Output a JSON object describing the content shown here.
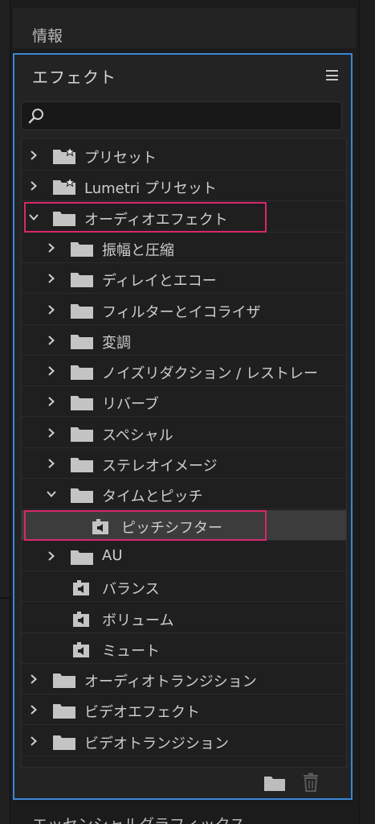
{
  "info_panel": {
    "title": "情報"
  },
  "effects_panel": {
    "title": "エフェクト",
    "search": {
      "placeholder": "",
      "value": ""
    },
    "tree": [
      {
        "label": "プリセット",
        "level": 0,
        "expanded": false,
        "icon": "preset-folder-icon",
        "has_chevron": true
      },
      {
        "label": "Lumetri プリセット",
        "level": 0,
        "expanded": false,
        "icon": "preset-folder-icon",
        "has_chevron": true
      },
      {
        "label": "オーディオエフェクト",
        "level": 0,
        "expanded": true,
        "icon": "folder-icon",
        "has_chevron": true
      },
      {
        "label": "振幅と圧縮",
        "level": 1,
        "expanded": false,
        "icon": "folder-icon",
        "has_chevron": true
      },
      {
        "label": "ディレイとエコー",
        "level": 1,
        "expanded": false,
        "icon": "folder-icon",
        "has_chevron": true
      },
      {
        "label": "フィルターとイコライザ",
        "level": 1,
        "expanded": false,
        "icon": "folder-icon",
        "has_chevron": true
      },
      {
        "label": "変調",
        "level": 1,
        "expanded": false,
        "icon": "folder-icon",
        "has_chevron": true
      },
      {
        "label": "ノイズリダクション / レストレー",
        "level": 1,
        "expanded": false,
        "icon": "folder-icon",
        "has_chevron": true
      },
      {
        "label": "リバーブ",
        "level": 1,
        "expanded": false,
        "icon": "folder-icon",
        "has_chevron": true
      },
      {
        "label": "スペシャル",
        "level": 1,
        "expanded": false,
        "icon": "folder-icon",
        "has_chevron": true
      },
      {
        "label": "ステレオイメージ",
        "level": 1,
        "expanded": false,
        "icon": "folder-icon",
        "has_chevron": true
      },
      {
        "label": "タイムとピッチ",
        "level": 1,
        "expanded": true,
        "icon": "folder-icon",
        "has_chevron": true
      },
      {
        "label": "ピッチシフター",
        "level": 2,
        "expanded": false,
        "icon": "audio-effect-icon",
        "has_chevron": false,
        "selected": true
      },
      {
        "label": "AU",
        "level": 1,
        "expanded": false,
        "icon": "folder-icon",
        "has_chevron": true
      },
      {
        "label": "バランス",
        "level": 1,
        "expanded": false,
        "icon": "audio-effect-icon",
        "has_chevron": false
      },
      {
        "label": "ボリューム",
        "level": 1,
        "expanded": false,
        "icon": "audio-effect-icon",
        "has_chevron": false
      },
      {
        "label": "ミュート",
        "level": 1,
        "expanded": false,
        "icon": "audio-effect-icon",
        "has_chevron": false
      },
      {
        "label": "オーディオトランジション",
        "level": 0,
        "expanded": false,
        "icon": "folder-icon",
        "has_chevron": true
      },
      {
        "label": "ビデオエフェクト",
        "level": 0,
        "expanded": false,
        "icon": "folder-icon",
        "has_chevron": true
      },
      {
        "label": "ビデオトランジション",
        "level": 0,
        "expanded": false,
        "icon": "folder-icon",
        "has_chevron": true
      }
    ]
  },
  "bottom_panel": {
    "title": "エッセンシャルグラフィックス"
  },
  "colors": {
    "panel_border": "#3a86d6",
    "highlight": "#d6286b",
    "selected_row": "#3c3c3c"
  }
}
